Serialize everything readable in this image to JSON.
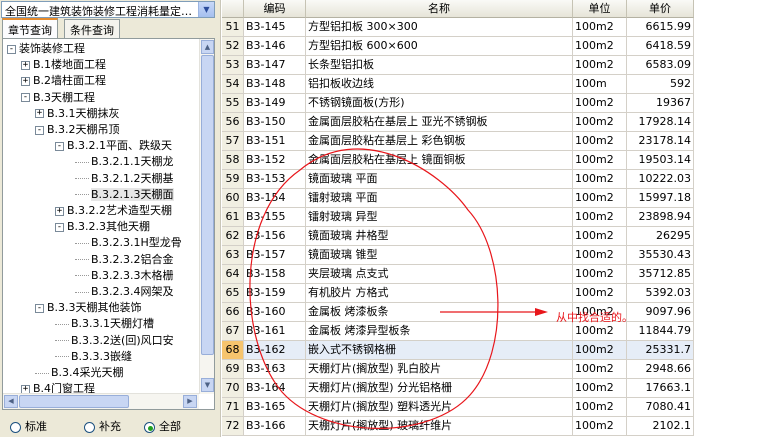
{
  "quota_selector": {
    "value": "全国统一建筑装饰装修工程消耗量定…"
  },
  "tabs": [
    {
      "label": "章节查询",
      "active": true
    },
    {
      "label": "条件查询",
      "active": false
    }
  ],
  "tree": [
    {
      "label": "装饰装修工程",
      "depth": 0,
      "toggle": "-"
    },
    {
      "label": "B.1楼地面工程",
      "depth": 1,
      "toggle": "+"
    },
    {
      "label": "B.2墙柱面工程",
      "depth": 1,
      "toggle": "+"
    },
    {
      "label": "B.3天棚工程",
      "depth": 1,
      "toggle": "-"
    },
    {
      "label": "B.3.1天棚抹灰",
      "depth": 2,
      "toggle": "+"
    },
    {
      "label": "B.3.2天棚吊顶",
      "depth": 2,
      "toggle": "-"
    },
    {
      "label": "B.3.2.1平面、跌级天",
      "depth": 3,
      "toggle": "-"
    },
    {
      "label": "B.3.2.1.1天棚龙",
      "depth": 4,
      "toggle": ""
    },
    {
      "label": "B.3.2.1.2天棚基",
      "depth": 4,
      "toggle": ""
    },
    {
      "label": "B.3.2.1.3天棚面",
      "depth": 4,
      "toggle": "",
      "selected": true
    },
    {
      "label": "B.3.2.2艺术造型天棚",
      "depth": 3,
      "toggle": "+"
    },
    {
      "label": "B.3.2.3其他天棚",
      "depth": 3,
      "toggle": "-"
    },
    {
      "label": "B.3.2.3.1H型龙骨",
      "depth": 4,
      "toggle": ""
    },
    {
      "label": "B.3.2.3.2铝合金",
      "depth": 4,
      "toggle": ""
    },
    {
      "label": "B.3.2.3.3木格栅",
      "depth": 4,
      "toggle": ""
    },
    {
      "label": "B.3.2.3.4网架及",
      "depth": 4,
      "toggle": ""
    },
    {
      "label": "B.3.3天棚其他装饰",
      "depth": 2,
      "toggle": "-"
    },
    {
      "label": "B.3.3.1天棚灯槽",
      "depth": 3,
      "toggle": ""
    },
    {
      "label": "B.3.3.2送(回)风口安",
      "depth": 3,
      "toggle": ""
    },
    {
      "label": "B.3.3.3嵌缝",
      "depth": 3,
      "toggle": ""
    },
    {
      "label": "B.3.4采光天棚",
      "depth": 2,
      "toggle": ""
    },
    {
      "label": "B.4门窗工程",
      "depth": 1,
      "toggle": "+"
    }
  ],
  "filters": [
    {
      "label": "标准",
      "checked": false
    },
    {
      "label": "补充",
      "checked": false
    },
    {
      "label": "全部",
      "checked": true
    }
  ],
  "table": {
    "headers": {
      "code": "编码",
      "name": "名称",
      "unit": "单位",
      "price": "单价"
    },
    "rows": [
      {
        "n": "51",
        "code": "B3-145",
        "name": "方型铝扣板 300×300",
        "unit": "100m2",
        "price": "6615.99"
      },
      {
        "n": "52",
        "code": "B3-146",
        "name": "方型铝扣板 600×600",
        "unit": "100m2",
        "price": "6418.59"
      },
      {
        "n": "53",
        "code": "B3-147",
        "name": "长条型铝扣板",
        "unit": "100m2",
        "price": "6583.09"
      },
      {
        "n": "54",
        "code": "B3-148",
        "name": "铝扣板收边线",
        "unit": "100m",
        "price": "592"
      },
      {
        "n": "55",
        "code": "B3-149",
        "name": "不锈钢镜面板(方形)",
        "unit": "100m2",
        "price": "19367"
      },
      {
        "n": "56",
        "code": "B3-150",
        "name": "金属面层胶粘在基层上 亚光不锈钢板",
        "unit": "100m2",
        "price": "17928.14"
      },
      {
        "n": "57",
        "code": "B3-151",
        "name": "金属面层胶粘在基层上 彩色钢板",
        "unit": "100m2",
        "price": "23178.14"
      },
      {
        "n": "58",
        "code": "B3-152",
        "name": "金属面层胶粘在基层上 镜面铜板",
        "unit": "100m2",
        "price": "19503.14"
      },
      {
        "n": "59",
        "code": "B3-153",
        "name": "镜面玻璃 平面",
        "unit": "100m2",
        "price": "10222.03"
      },
      {
        "n": "60",
        "code": "B3-154",
        "name": "镭射玻璃 平面",
        "unit": "100m2",
        "price": "15997.18"
      },
      {
        "n": "61",
        "code": "B3-155",
        "name": "镭射玻璃 异型",
        "unit": "100m2",
        "price": "23898.94"
      },
      {
        "n": "62",
        "code": "B3-156",
        "name": "镜面玻璃 井格型",
        "unit": "100m2",
        "price": "26295"
      },
      {
        "n": "63",
        "code": "B3-157",
        "name": "镜面玻璃 锥型",
        "unit": "100m2",
        "price": "35530.43"
      },
      {
        "n": "64",
        "code": "B3-158",
        "name": "夹层玻璃 点支式",
        "unit": "100m2",
        "price": "35712.85"
      },
      {
        "n": "65",
        "code": "B3-159",
        "name": "有机胶片 方格式",
        "unit": "100m2",
        "price": "5392.03"
      },
      {
        "n": "66",
        "code": "B3-160",
        "name": "金属板 烤漆板条",
        "unit": "100m2",
        "price": "9097.96"
      },
      {
        "n": "67",
        "code": "B3-161",
        "name": "金属板 烤漆异型板条",
        "unit": "100m2",
        "price": "11844.79"
      },
      {
        "n": "68",
        "code": "B3-162",
        "name": "嵌入式不锈钢格栅",
        "unit": "100m2",
        "price": "25331.7",
        "selected": true
      },
      {
        "n": "69",
        "code": "B3-163",
        "name": "天棚灯片(搁放型) 乳白胶片",
        "unit": "100m2",
        "price": "2948.66"
      },
      {
        "n": "70",
        "code": "B3-164",
        "name": "天棚灯片(搁放型) 分光铝格栅",
        "unit": "100m2",
        "price": "17663.1"
      },
      {
        "n": "71",
        "code": "B3-165",
        "name": "天棚灯片(搁放型) 塑料透光片",
        "unit": "100m2",
        "price": "7080.41"
      },
      {
        "n": "72",
        "code": "B3-166",
        "name": "天棚灯片(搁放型) 玻璃纤维片",
        "unit": "100m2",
        "price": "2102.1"
      }
    ]
  },
  "annotation": {
    "text": "从中找合适的。",
    "color": "#e8161b"
  }
}
